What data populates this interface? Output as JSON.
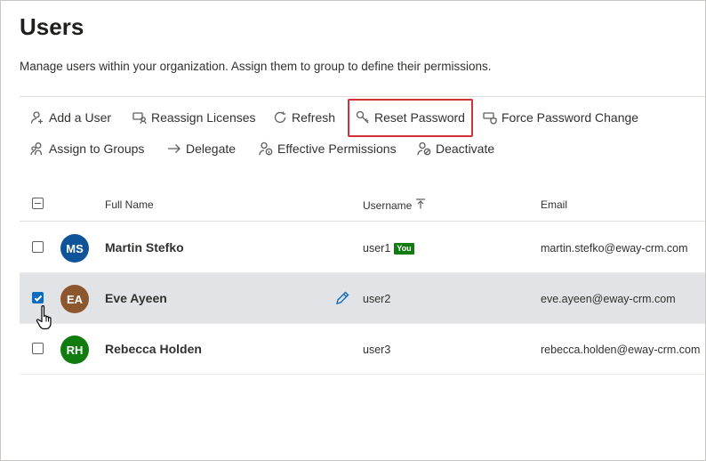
{
  "page": {
    "title": "Users",
    "description": "Manage users within your organization. Assign them to group to define their permissions."
  },
  "toolbar": {
    "row1": [
      {
        "id": "add-user",
        "label": "Add a User",
        "icon": "add-person-icon"
      },
      {
        "id": "reassign-licenses",
        "label": "Reassign Licenses",
        "icon": "reassign-icon"
      },
      {
        "id": "refresh",
        "label": "Refresh",
        "icon": "refresh-icon"
      },
      {
        "id": "reset-password",
        "label": "Reset Password",
        "icon": "key-icon"
      },
      {
        "id": "force-password-change",
        "label": "Force Password Change",
        "icon": "shield-password-icon"
      }
    ],
    "row2": [
      {
        "id": "assign-groups",
        "label": "Assign to Groups",
        "icon": "group-icon"
      },
      {
        "id": "delegate",
        "label": "Delegate",
        "icon": "arrow-right-icon"
      },
      {
        "id": "effective-permissions",
        "label": "Effective Permissions",
        "icon": "person-info-icon"
      },
      {
        "id": "deactivate",
        "label": "Deactivate",
        "icon": "person-block-icon"
      }
    ],
    "highlighted": "Reset Password",
    "highlight_color": "#d13438"
  },
  "table": {
    "columns": {
      "full_name": "Full Name",
      "username": "Username",
      "email": "Email"
    },
    "sort_icon": "sort-ascending-icon",
    "rows": [
      {
        "initials": "MS",
        "avatar_color": "#0f5499",
        "name": "Martin Stefko",
        "username": "user1",
        "badge": "You",
        "email": "martin.stefko@eway-crm.com",
        "checked": false
      },
      {
        "initials": "EA",
        "avatar_color": "#8e562e",
        "name": "Eve Ayeen",
        "username": "user2",
        "badge": "",
        "email": "eve.ayeen@eway-crm.com",
        "checked": true
      },
      {
        "initials": "RH",
        "avatar_color": "#107c10",
        "name": "Rebecca Holden",
        "username": "user3",
        "badge": "",
        "email": "rebecca.holden@eway-crm.com",
        "checked": false
      }
    ]
  },
  "colors": {
    "accent": "#0f6cbd",
    "selected_row": "#e1e3e6",
    "you_badge": "#107c10"
  }
}
